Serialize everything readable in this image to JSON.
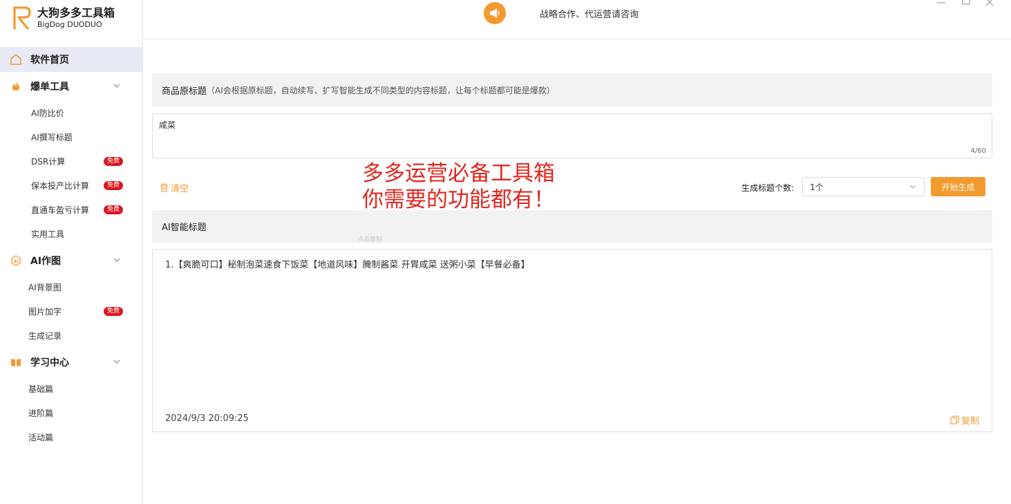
{
  "brand": {
    "name_cn": "大狗多多工具箱",
    "name_en": "BigDog DUODUO",
    "accent": "#f39a2e",
    "badge_color": "#d7191f"
  },
  "header": {
    "notice": "战略合作、代运营请咨询"
  },
  "sidebar": {
    "home": "软件首页",
    "groups": [
      {
        "label": "爆单工具",
        "icon": "flame-icon",
        "items": [
          {
            "label": "AI防比价"
          },
          {
            "label": "AI撰写标题"
          },
          {
            "label": "DSR计算",
            "badge": "免费"
          },
          {
            "label": "保本投产比计算",
            "badge": "免费"
          },
          {
            "label": "直通车盈亏计算",
            "badge": "免费"
          },
          {
            "label": "实用工具"
          }
        ]
      },
      {
        "label": "AI作图",
        "icon": "ai-icon",
        "items": [
          {
            "label": "AI背景图"
          },
          {
            "label": "图片加字",
            "badge": "免费"
          },
          {
            "label": "生成记录"
          }
        ]
      },
      {
        "label": "学习中心",
        "icon": "book-icon",
        "items": [
          {
            "label": "基础篇"
          },
          {
            "label": "进阶篇"
          },
          {
            "label": "活动篇"
          }
        ]
      }
    ]
  },
  "main": {
    "original_title_label": "商品原标题",
    "original_title_hint": "（AI会根据原标题，自动续写、扩写智能生成不同类型的内容标题，让每个标题都可能是爆款）",
    "input_value": "咸菜",
    "input_counter": "4/60",
    "clear_label": "清空",
    "promo_line1": "多多运营必备工具箱",
    "promo_line2": "你需要的功能都有！",
    "count_label": "生成标题个数:",
    "count_value": "1个",
    "generate_label": "开始生成",
    "ai_title_header": "AI智能标题",
    "ghost_text": "点击复制",
    "result_line": "1.【爽脆可口】秘制泡菜速食下饭菜【地道风味】腌制酱菜 开胃咸菜 送粥小菜【早餐必备】",
    "result_time": "2024/9/3 20:09:25",
    "copy_label": "复制"
  }
}
